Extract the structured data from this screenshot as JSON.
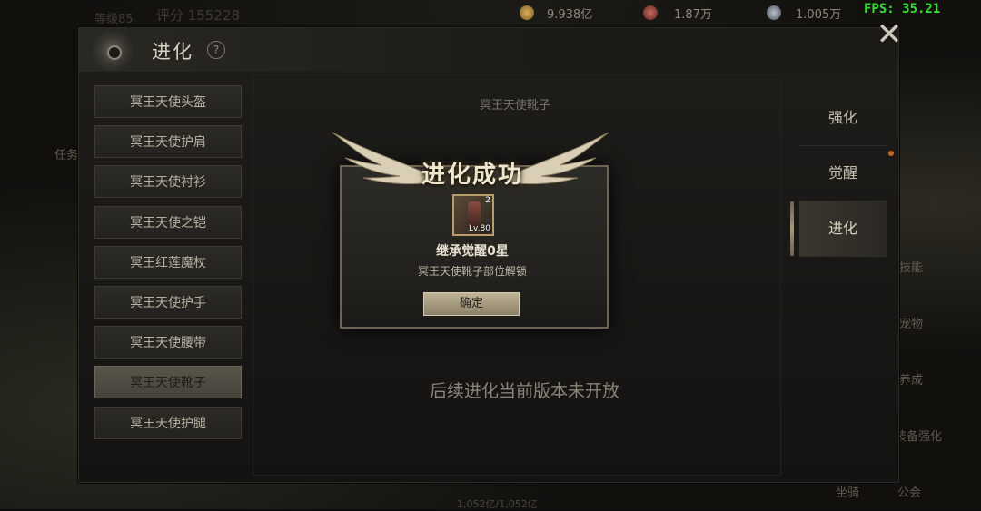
{
  "background": {
    "level_text": "等级85",
    "score_text": "评分 155228",
    "bottom_value": "1,052亿/1,052亿"
  },
  "topbar": {
    "currencies": [
      {
        "icon": "gold-coin-icon",
        "value": "9.938亿"
      },
      {
        "icon": "red-gem-icon",
        "value": "1.87万"
      },
      {
        "icon": "crystal-icon",
        "value": "1.005万"
      }
    ],
    "fps": "FPS: 35.21"
  },
  "panel": {
    "title": "进化",
    "help": "?",
    "close": "✕"
  },
  "equipment_list": [
    {
      "label": "冥王天使头盔"
    },
    {
      "label": "冥王天使护肩"
    },
    {
      "label": "冥王天使衬衫"
    },
    {
      "label": "冥王天使之铠"
    },
    {
      "label": "冥王红莲魔杖"
    },
    {
      "label": "冥王天使护手"
    },
    {
      "label": "冥王天使腰带"
    },
    {
      "label": "冥王天使靴子",
      "selected": true
    },
    {
      "label": "冥王天使护腿"
    }
  ],
  "center": {
    "target_label": "冥王天使靴子",
    "notice": "后续进化当前版本未开放"
  },
  "tabs": [
    {
      "label": "强化"
    },
    {
      "label": "觉醒"
    },
    {
      "label": "进化",
      "active": true
    }
  ],
  "side_menu": [
    "任务",
    "技能",
    "宠物",
    "养成",
    "装备强化",
    "坐骑",
    "公会"
  ],
  "modal": {
    "title": "进化成功",
    "item": {
      "level": "Lv.80",
      "count": "2"
    },
    "inherit_text": "继承觉醒0星",
    "unlock_text": "冥王天使靴子部位解锁",
    "confirm_label": "确定"
  }
}
